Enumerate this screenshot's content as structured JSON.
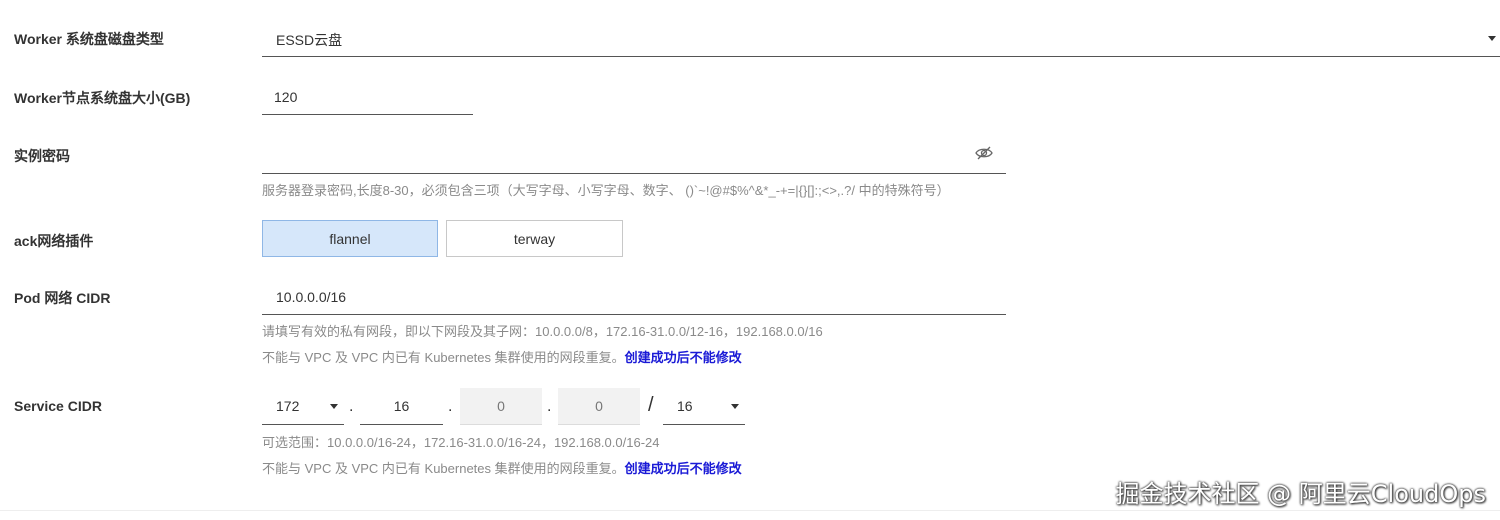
{
  "worker_disk_type": {
    "label": "Worker 系统盘磁盘类型",
    "value": "ESSD云盘"
  },
  "worker_disk_size": {
    "label": "Worker节点系统盘大小(GB)",
    "value": "120"
  },
  "instance_password": {
    "label": "实例密码",
    "value": "",
    "help": "服务器登录密码,长度8-30，必须包含三项（大写字母、小写字母、数字、 ()`~!@#$%^&*_-+=|{}[]:;<>,.?/ 中的特殊符号）"
  },
  "network_plugin": {
    "label": "ack网络插件",
    "options": [
      "flannel",
      "terway"
    ],
    "selected": "flannel"
  },
  "pod_cidr": {
    "label": "Pod 网络 CIDR",
    "value": "10.0.0.0/16",
    "help_1": "请填写有效的私有网段，即以下网段及其子网：10.0.0.0/8，172.16-31.0.0/12-16，192.168.0.0/16",
    "help_2": "不能与 VPC 及 VPC 内已有 Kubernetes 集群使用的网段重复。",
    "help_2_strong": "创建成功后不能修改"
  },
  "service_cidr": {
    "label": "Service CIDR",
    "octet1": "172",
    "octet2": "16",
    "octet3": "0",
    "octet4": "0",
    "mask": "16",
    "sep_dot": ".",
    "sep_slash": "/",
    "help_1": "可选范围：10.0.0.0/16-24，172.16-31.0.0/16-24，192.168.0.0/16-24",
    "help_2": "不能与 VPC 及 VPC 内已有 Kubernetes 集群使用的网段重复。",
    "help_2_strong": "创建成功后不能修改"
  },
  "watermark": "掘金技术社区 @ 阿里云CloudOps",
  "icons": {
    "password_toggle": "eye-off-icon",
    "dropdown": "caret-down-icon"
  },
  "colors": {
    "selected_bg": "#d6e7fa",
    "emphasis_text": "#1a1ad6",
    "help_text": "#8a8a8a"
  }
}
